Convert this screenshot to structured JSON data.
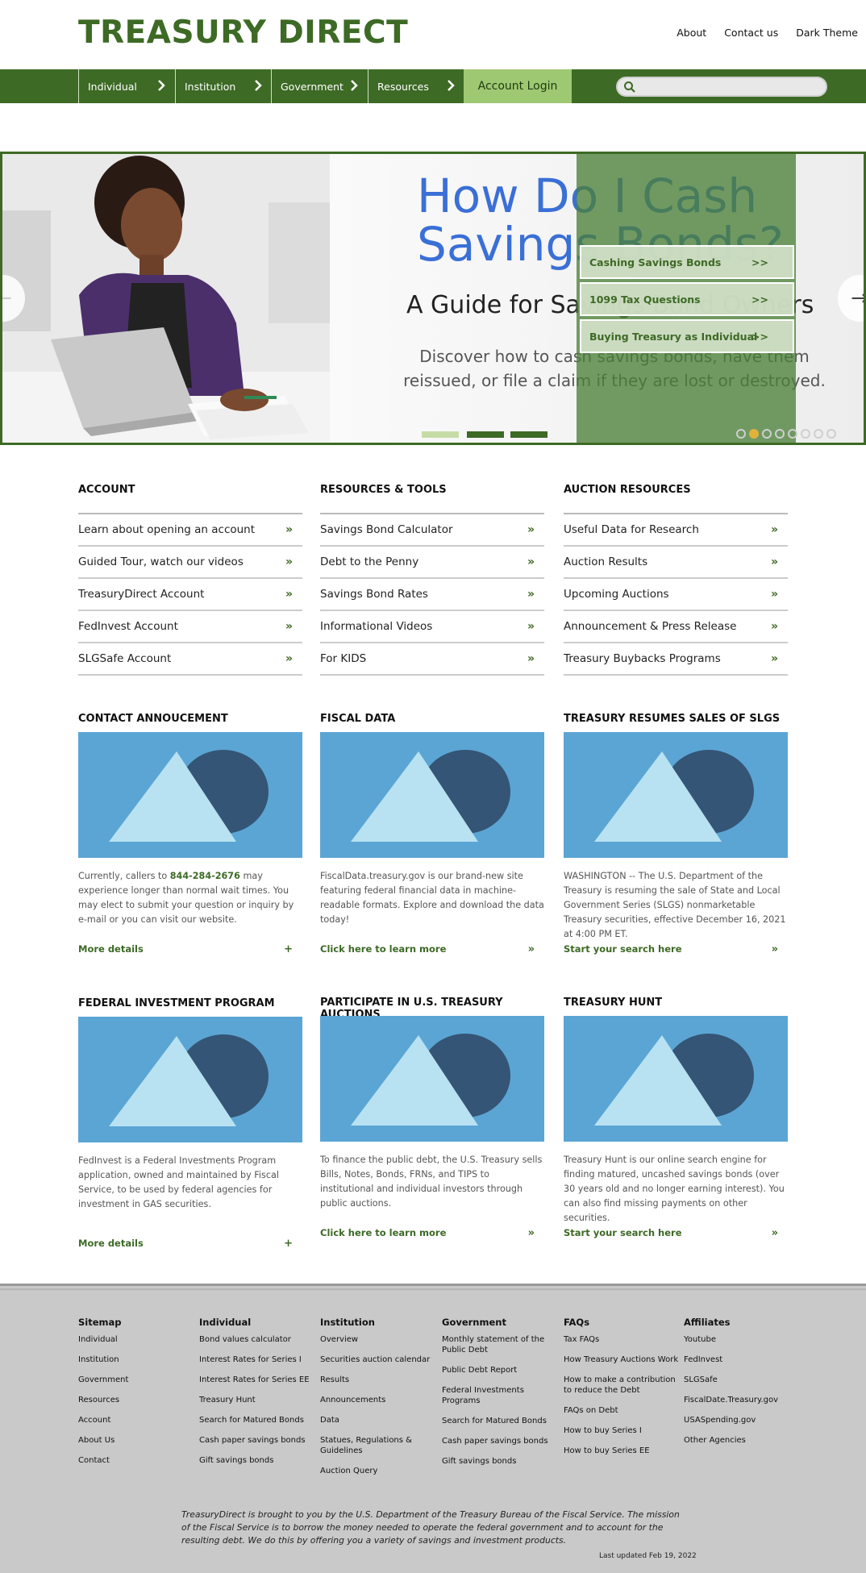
{
  "header": {
    "logo": "TREASURY DIRECT",
    "links": [
      "About",
      "Contact us",
      "Dark Theme"
    ]
  },
  "nav": {
    "items": [
      "Individual",
      "Institution",
      "Government",
      "Resources"
    ],
    "login": "Account Login",
    "search_placeholder": ""
  },
  "hero": {
    "title_line1": "How Do I Cash",
    "title_line2": "Savings Bonds?",
    "subtitle": "A Guide for Savings Bond Owners",
    "description": "Discover how to cash savings bonds, have them reissued, or file a claim if they are lost or destroyed.",
    "quicklinks": [
      {
        "label": "Cashing Savings Bonds",
        "arrow": ">>"
      },
      {
        "label": "1099 Tax Questions",
        "arrow": ">>"
      },
      {
        "label": "Buying Treasury as Individual",
        "arrow": ">>"
      }
    ],
    "slides_total": 8,
    "active_slide": 2,
    "colors": {
      "accent": "#3d6a25",
      "title": "#3a6fd6"
    }
  },
  "columns": [
    {
      "title": "ACCOUNT",
      "items": [
        "Learn about opening an account",
        "Guided Tour, watch our videos",
        "TreasuryDirect Account",
        "FedInvest Account",
        "SLGSafe Account"
      ]
    },
    {
      "title": "RESOURCES & TOOLS",
      "items": [
        "Savings Bond Calculator",
        "Debt to the Penny",
        "Savings Bond Rates",
        "Informational Videos",
        "For KIDS"
      ]
    },
    {
      "title": "AUCTION RESOURCES",
      "items": [
        "Useful Data for Research",
        "Auction Results",
        "Upcoming Auctions",
        "Announcement & Press Release",
        "Treasury Buybacks Programs"
      ]
    }
  ],
  "cards": [
    {
      "title": "CONTACT ANNOUCEMENT",
      "text_pre": "Currently, callers to ",
      "text_bold": "844-284-2676",
      "text_post": " may experience longer than normal wait times. You may elect to submit your question or inquiry by e-mail or you can visit our website.",
      "link": "More details",
      "link_icon": "+"
    },
    {
      "title": "FISCAL DATA",
      "text_pre": "FiscalData.treasury.gov is our brand-new site featuring federal financial data in machine-readable formats. Explore and download the data today!",
      "text_bold": "",
      "text_post": "",
      "link": "Click here to learn more",
      "link_icon": "»"
    },
    {
      "title": "TREASURY RESUMES SALES OF SLGS",
      "text_pre": "WASHINGTON -- The U.S. Department of the Treasury is resuming the sale of State and Local Government Series (SLGS) nonmarketable Treasury securities, effective December 16, 2021 at 4:00 PM ET.",
      "text_bold": "",
      "text_post": "",
      "link": "Start your search here",
      "link_icon": "»"
    },
    {
      "title": "FEDERAL INVESTMENT PROGRAM",
      "text_pre": "FedInvest is a Federal Investments Program application, owned and maintained by Fiscal Service, to be used by federal agencies for investment in GAS securities.",
      "text_bold": "",
      "text_post": "",
      "link": "More details",
      "link_icon": "+"
    },
    {
      "title": "PARTICIPATE IN U.S. TREASURY AUCTIONS",
      "text_pre": "To finance the public debt, the U.S. Treasury sells Bills, Notes, Bonds, FRNs, and TIPS to institutional and individual investors through public auctions.",
      "text_bold": "",
      "text_post": "",
      "link": "Click here to learn more",
      "link_icon": "»"
    },
    {
      "title": "TREASURY HUNT",
      "text_pre": "Treasury Hunt is our online search engine for finding matured, uncashed savings bonds (over 30 years old and no longer earning interest). You can also find missing payments on other securities.",
      "text_bold": "",
      "text_post": "",
      "link": "Start your search here",
      "link_icon": "»"
    }
  ],
  "footer": {
    "columns": [
      {
        "title": "Sitemap",
        "links": [
          "Individual",
          "Institution",
          "Government",
          "Resources",
          "Account",
          "About Us",
          "Contact"
        ]
      },
      {
        "title": "Individual",
        "links": [
          "Bond values calculator",
          "Interest Rates for Series I",
          "Interest Rates for Series EE",
          "Treasury Hunt",
          "Search for Matured Bonds",
          "Cash paper savings bonds",
          "Gift savings bonds"
        ]
      },
      {
        "title": "Institution",
        "links": [
          "Overview",
          "Securities auction calendar",
          "Results",
          "Announcements",
          "Data",
          "Statues, Regulations & Guidelines",
          "Auction Query"
        ]
      },
      {
        "title": "Government",
        "links": [
          "Monthly statement of the Public Debt",
          "Public Debt Report",
          "Federal Investments Programs",
          "Search for Matured Bonds",
          "Cash paper savings bonds",
          "Gift savings bonds"
        ]
      },
      {
        "title": "FAQs",
        "links": [
          "Tax FAQs",
          "How Treasury Auctions Work",
          "How to make a contribution to reduce the Debt",
          "FAQs on Debt",
          "How to buy Series I",
          "How to buy Series EE"
        ]
      },
      {
        "title": "Affiliates",
        "links": [
          "Youtube",
          "FedInvest",
          "SLGSafe",
          "FiscalDate.Treasury.gov",
          "USASpending.gov",
          "Other Agencies"
        ]
      }
    ],
    "about": "TreasuryDirect is brought to you by the U.S. Department of the Treasury Bureau of the Fiscal Service. The mission of  the Fiscal Service is to borrow the money needed to operate the federal government and to account for the resulting debt. We do this by offering you a variety of savings and investment products.",
    "updated": "Last updated Feb 19, 2022"
  }
}
